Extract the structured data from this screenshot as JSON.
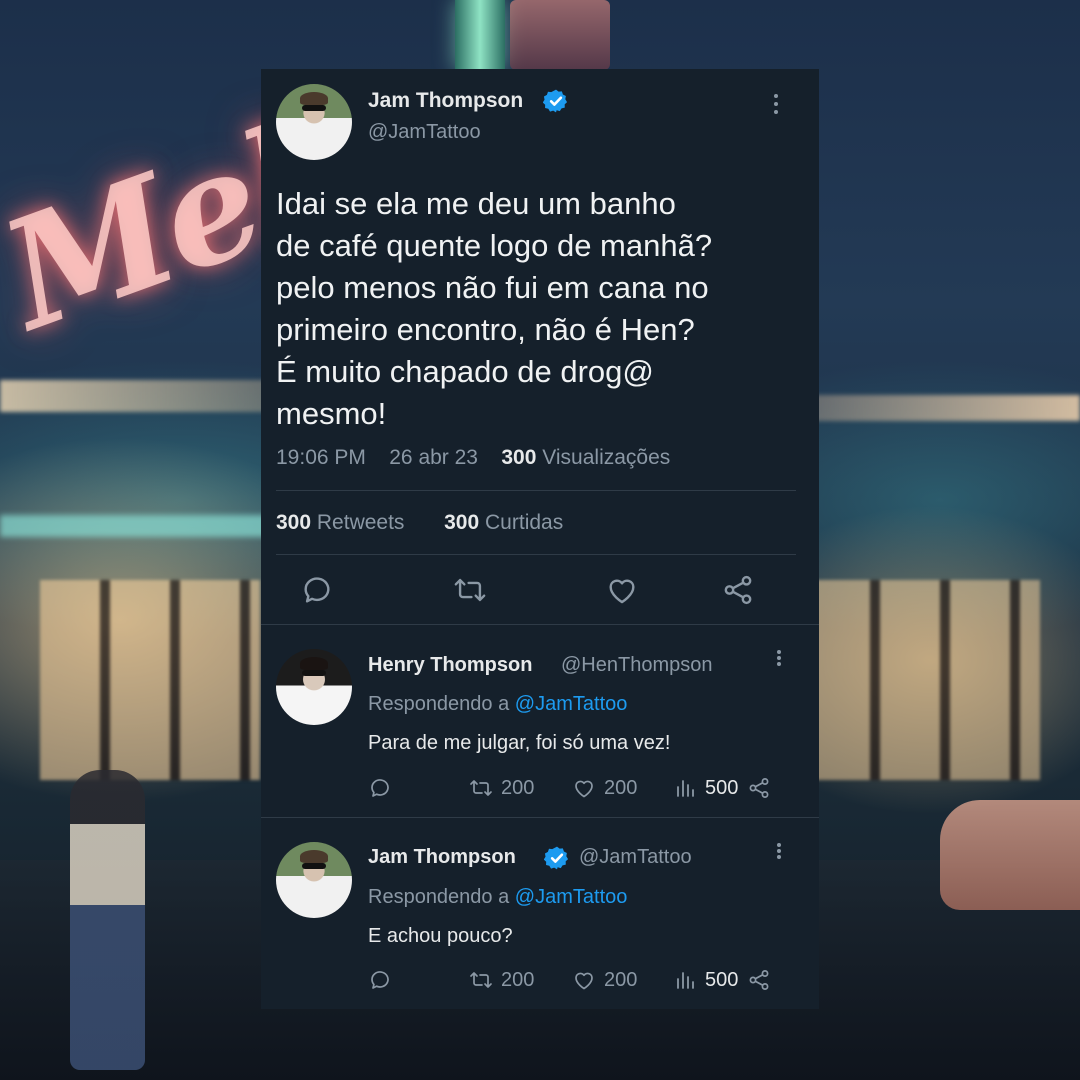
{
  "main_tweet": {
    "author_name": "Jam Thompson",
    "author_handle": "@JamTattoo",
    "text": "Idai se ela me deu um banho\nde café quente logo de manhã?\npelo menos não fui em cana no\nprimeiro encontro, não é Hen?\nÉ muito chapado de drog@\nmesmo!",
    "time": "19:06 PM",
    "date": "26 abr 23",
    "views_count": "300",
    "views_label": "Visualizações",
    "retweets_count": "300",
    "retweets_label": "Retweets",
    "likes_count": "300",
    "likes_label": "Curtidas",
    "actions": [
      "reply-icon",
      "retweet-icon",
      "like-icon",
      "share-icon"
    ]
  },
  "replies": [
    {
      "author_name": "Henry Thompson",
      "author_handle": "@HenThompson",
      "verified": false,
      "replying_label": "Respondendo a",
      "replying_to": "@JamTattoo",
      "text": "Para de me julgar, foi só uma vez!",
      "retweets": "200",
      "likes": "200",
      "views": "500"
    },
    {
      "author_name": "Jam Thompson",
      "author_handle": "@JamTattoo",
      "verified": true,
      "replying_label": "Respondendo a",
      "replying_to": "@JamTattoo",
      "text": "E achou pouco?",
      "retweets": "200",
      "likes": "200",
      "views": "500"
    }
  ],
  "colors": {
    "card_background": "#15202b",
    "verified_blue": "#1d9bf0",
    "muted_text": "#8b98a5",
    "primary_text": "#e7e9ea",
    "divider": "#2f3b47"
  }
}
